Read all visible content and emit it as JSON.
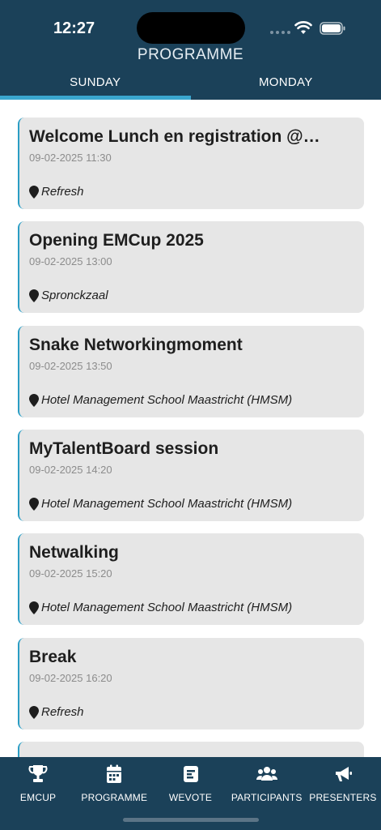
{
  "status_bar": {
    "time": "12:27"
  },
  "header": {
    "title": "PROGRAMME"
  },
  "tabs": [
    {
      "label": "SUNDAY",
      "active": true
    },
    {
      "label": "MONDAY",
      "active": false
    }
  ],
  "events": [
    {
      "title": "Welcome Lunch en registration @…",
      "datetime": "09-02-2025 11:30",
      "location": "Refresh"
    },
    {
      "title": "Opening EMCup 2025",
      "datetime": "09-02-2025 13:00",
      "location": "Spronckzaal"
    },
    {
      "title": "Snake Networkingmoment",
      "datetime": "09-02-2025 13:50",
      "location": "Hotel Management School Maastricht (HMSM)"
    },
    {
      "title": "MyTalentBoard session",
      "datetime": "09-02-2025 14:20",
      "location": "Hotel Management School Maastricht (HMSM)"
    },
    {
      "title": "Netwalking",
      "datetime": "09-02-2025 15:20",
      "location": "Hotel Management School Maastricht (HMSM)"
    },
    {
      "title": "Break",
      "datetime": "09-02-2025 16:20",
      "location": "Refresh"
    }
  ],
  "bottom_nav": [
    {
      "label": "EMCUP",
      "icon": "trophy-icon"
    },
    {
      "label": "PROGRAMME",
      "icon": "calendar-icon"
    },
    {
      "label": "WEVOTE",
      "icon": "poll-icon"
    },
    {
      "label": "PARTICIPANTS",
      "icon": "users-icon"
    },
    {
      "label": "PRESENTERS",
      "icon": "megaphone-icon"
    }
  ],
  "colors": {
    "header_bg": "#1b4159",
    "accent": "#3aa6cf",
    "card_bg": "#e6e6e6"
  }
}
